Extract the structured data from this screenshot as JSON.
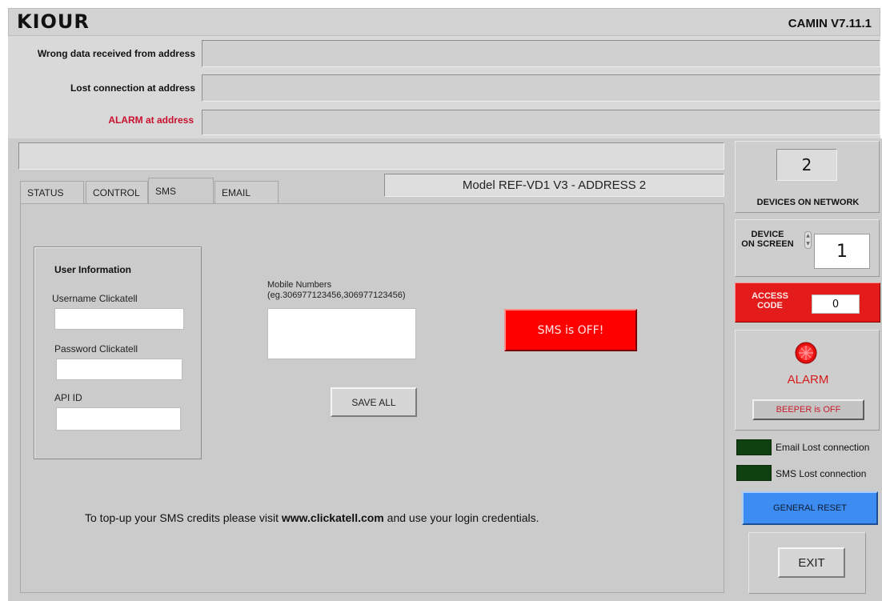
{
  "app": {
    "brand": "KIOUR",
    "version": "CAMIN V7.11.1"
  },
  "status_fields": {
    "wrong_data_label": "Wrong data received from address",
    "lost_connection_label": "Lost connection at address",
    "alarm_label": "ALARM at address",
    "alarm_label_color": "#c8102e"
  },
  "model_display": "Model REF-VD1 V3 -  ADDRESS  2",
  "tabs": [
    {
      "label": "STATUS"
    },
    {
      "label": "CONTROL"
    },
    {
      "label": "SMS"
    },
    {
      "label": "EMAIL"
    }
  ],
  "sms_tab": {
    "user_info_title": "User Information",
    "username_label": "Username Clickatell",
    "username_value": "",
    "password_label": "Password Clickatell",
    "password_value": "",
    "api_label": "API ID",
    "api_value": "",
    "mobile_label_line1": "Mobile Numbers",
    "mobile_label_line2": "(eg.306977123456,306977123456)",
    "mobile_value": "",
    "sms_status_button": "SMS is OFF!",
    "save_button": "SAVE ALL",
    "footer_pre": "To top-up your SMS credits please visit ",
    "footer_link": "www.clickatell.com",
    "footer_post": " and use your login credentials."
  },
  "side_panel": {
    "devices_count": "2",
    "devices_label": "DEVICES ON NETWORK",
    "device_on_screen_line1": "DEVICE",
    "device_on_screen_line2": "ON SCREEN",
    "device_on_screen_value": "1",
    "access_code_line1": "ACCESS",
    "access_code_line2": "CODE",
    "access_code_value": "0",
    "alarm_text": "ALARM",
    "beeper_button": "BEEPER is OFF",
    "email_lost_label": "Email Lost connection",
    "sms_lost_label": "SMS Lost connection",
    "general_reset": "GENERAL RESET",
    "exit": "EXIT"
  },
  "colors": {
    "alarm_red": "#e00000",
    "access_red": "#e41b1b",
    "reset_blue": "#3d8cf2",
    "led_off_green": "#114011"
  }
}
